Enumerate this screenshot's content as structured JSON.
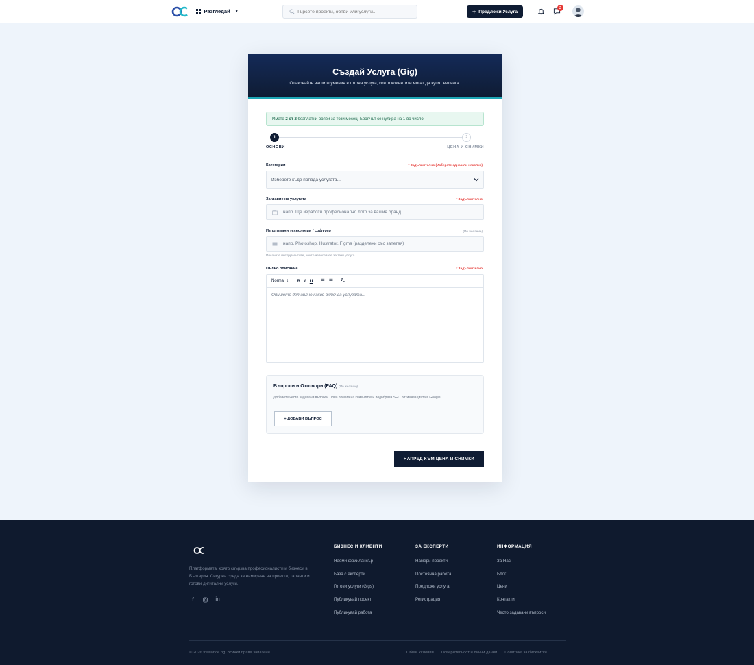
{
  "header": {
    "browse_label": "Разгледай",
    "search_placeholder": "Търсете проекти, обяви или услуги...",
    "offer_button": "Предложи Услуга",
    "messages_badge": "2",
    "accent": "#0f1c33"
  },
  "card": {
    "title": "Създай Услуга (Gig)",
    "subtitle": "Опаковайте вашите умения в готова услуга, която клиентите могат да купят веднага.",
    "notice_prefix": "Имате ",
    "notice_count": "2 от 2",
    "notice_suffix": " безплатни обяви за този месец. Броячът се нулира на 1-во число.",
    "steps": [
      {
        "number": "1",
        "label": "ОСНОВИ"
      },
      {
        "number": "2",
        "label": "ЦЕНА И СНИМКИ"
      }
    ],
    "category": {
      "label": "Категории",
      "required": "* Задължително (Изберете една или няколко)",
      "placeholder": "Изберете къде попада услугата..."
    },
    "service_title": {
      "label": "Заглавие на услугата",
      "required": "* Задължително",
      "placeholder": "напр. Ще изработя професионално лого за вашия бранд"
    },
    "technologies": {
      "label": "Използвани технологии / софтуер",
      "optional": "(По желание)",
      "placeholder": "напр. Photoshop, Illustrator, Figma (разделени със запетая)",
      "hint": "Посочете инструментите, които използвате за тази услуга."
    },
    "description": {
      "label": "Пълно описание",
      "required": "* Задължително",
      "format": "Normal",
      "placeholder": "Опишете детайлно какво включва услугата..."
    },
    "faq": {
      "title": "Въпроси и Отговори (FAQ)",
      "optional": "(По желание)",
      "text": "Добавете често задавани въпроси. Това помага на клиентите и подобрява SEO оптимизацията в Google.",
      "add_button": "+ ДОБАВИ ВЪПРОС"
    },
    "next_button": "НАПРЕД КЪМ ЦЕНА И СНИМКИ"
  },
  "footer": {
    "description": "Платформата, която свързва професионалисти и бизнеси в България. Сигурна среда за намиране на проекти, таланти и готови дигитални услуги.",
    "columns": [
      {
        "title": "БИЗНЕС И КЛИЕНТИ",
        "links": [
          "Наеми фрийлансър",
          "База с експерти",
          "Готови услуги (Gigs)",
          "Публикувай проект",
          "Публикувай работа"
        ]
      },
      {
        "title": "ЗА ЕКСПЕРТИ",
        "links": [
          "Намери проекти",
          "Постоянна работа",
          "Предложи услуга",
          "Регистрация"
        ]
      },
      {
        "title": "ИНФОРМАЦИЯ",
        "links": [
          "За Нас",
          "Блог",
          "Цени",
          "Контакти",
          "Често задавани въпроси"
        ]
      }
    ],
    "copyright": "© 2026 freelance.bg. Всички права запазени.",
    "legal_links": [
      "Общи Условия",
      "Поверителност и лични данни",
      "Политика за бисквитки"
    ]
  }
}
